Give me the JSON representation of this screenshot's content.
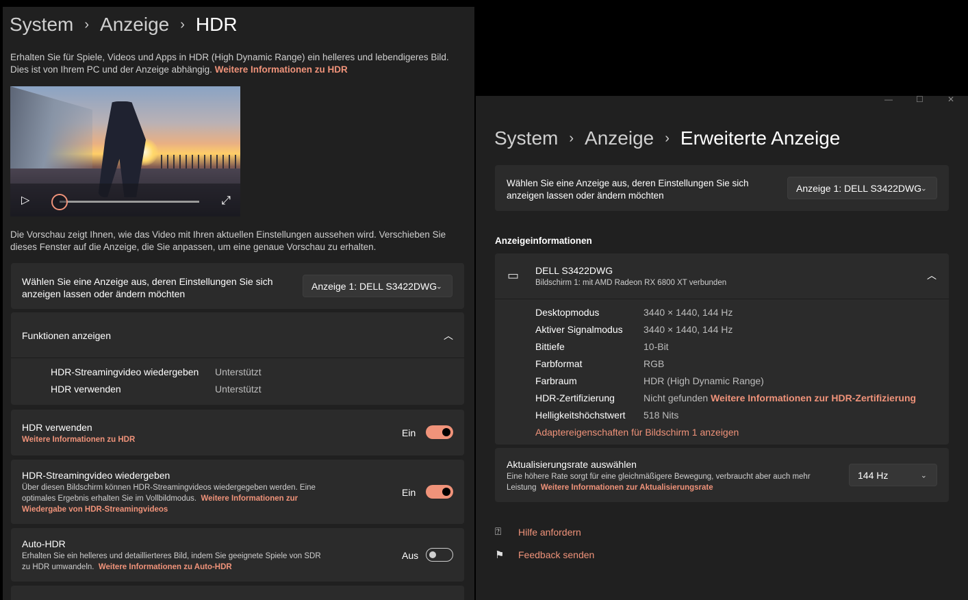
{
  "left": {
    "breadcrumb": {
      "part1": "System",
      "part2": "Anzeige",
      "current": "HDR",
      "sep": "›"
    },
    "intro": {
      "line1": "Erhalten Sie für Spiele, Videos und Apps in HDR (High Dynamic Range) ein helleres und lebendigeres Bild.",
      "line2": "Dies ist von Ihrem PC und der Anzeige abhängig.",
      "link": "Weitere Informationen zu HDR"
    },
    "preview": {
      "play_icon": "play-icon",
      "expand_icon": "expand-icon",
      "progress": 0.0
    },
    "preview_desc": {
      "line1": "Die Vorschau zeigt Ihnen, wie das Video mit Ihren aktuellen Einstellungen aussehen wird. Verschieben Sie",
      "line2": "dieses Fenster auf die Anzeige, die Sie anpassen, um eine genaue Vorschau zu erhalten."
    },
    "select_display": {
      "line1": "Wählen Sie eine Anzeige aus, deren Einstellungen Sie sich",
      "line2": "anzeigen lassen oder ändern möchten",
      "value": "Anzeige 1: DELL S3422DWG"
    },
    "features": {
      "title": "Funktionen anzeigen",
      "rows": [
        {
          "label": "HDR-Streamingvideo wiedergeben",
          "value": "Unterstützt"
        },
        {
          "label": "HDR verwenden",
          "value": "Unterstützt"
        }
      ]
    },
    "use_hdr": {
      "title": "HDR verwenden",
      "link": "Weitere Informationen zu HDR",
      "state": "Ein",
      "on": true
    },
    "streaming": {
      "title": "HDR-Streamingvideo wiedergeben",
      "line1": "Über diesen Bildschirm können HDR-Streamingvideos wiedergegeben werden. Eine",
      "line2": "optimales Ergebnis erhalten Sie im Vollbildmodus.",
      "link1": "Weitere Informationen zur",
      "link2": "Wiedergabe von HDR-Streamingvideos",
      "state": "Ein",
      "on": true
    },
    "auto_hdr": {
      "title": "Auto-HDR",
      "line1": "Erhalten Sie ein helleres und detaillierteres Bild, indem Sie geeignete Spiele von SDR",
      "line2": "zu HDR umwandeln.",
      "link": "Weitere Informationen zu Auto-HDR",
      "state": "Aus",
      "on": false
    }
  },
  "right": {
    "caption": {
      "min": "—",
      "max": "☐",
      "close": "✕"
    },
    "breadcrumb": {
      "part1": "System",
      "part2": "Anzeige",
      "current": "Erweiterte Anzeige",
      "sep": "›"
    },
    "select_display": {
      "line1": "Wählen Sie eine Anzeige aus, deren Einstellungen Sie sich",
      "line2": "anzeigen lassen oder ändern möchten",
      "value": "Anzeige 1: DELL S3422DWG"
    },
    "section_title": "Anzeigeinformationen",
    "monitor": {
      "icon": "laptop-icon",
      "name": "DELL S3422DWG",
      "subtitle": "Bildschirm 1: mit AMD Radeon RX 6800 XT verbunden",
      "rows": [
        {
          "label": "Desktopmodus",
          "value": "3440 × 1440, 144 Hz"
        },
        {
          "label": "Aktiver Signalmodus",
          "value": "3440 × 1440, 144 Hz"
        },
        {
          "label": "Bittiefe",
          "value": "10-Bit"
        },
        {
          "label": "Farbformat",
          "value": "RGB"
        },
        {
          "label": "Farbraum",
          "value": "HDR (High Dynamic Range)"
        },
        {
          "label": "HDR-Zertifizierung",
          "value": "Nicht gefunden",
          "link": "Weitere Informationen zur HDR-Zertifizierung"
        },
        {
          "label": "Helligkeitshöchstwert",
          "value": "518 Nits"
        }
      ],
      "adapter_link": "Adaptereigenschaften für Bildschirm 1 anzeigen"
    },
    "refresh": {
      "title": "Aktualisierungsrate auswählen",
      "line1": "Eine höhere Rate sorgt für eine gleichmäßigere Bewegung, verbraucht aber auch mehr",
      "line2": "Leistung",
      "link": "Weitere Informationen zur Aktualisierungsrate",
      "value": "144 Hz"
    },
    "help": {
      "label": "Hilfe anfordern",
      "icon": "help-icon"
    },
    "feedback": {
      "label": "Feedback senden",
      "icon": "feedback-icon"
    }
  },
  "colors": {
    "accent": "#f0937a",
    "card": "#2b2b2b",
    "window": "#202020"
  }
}
